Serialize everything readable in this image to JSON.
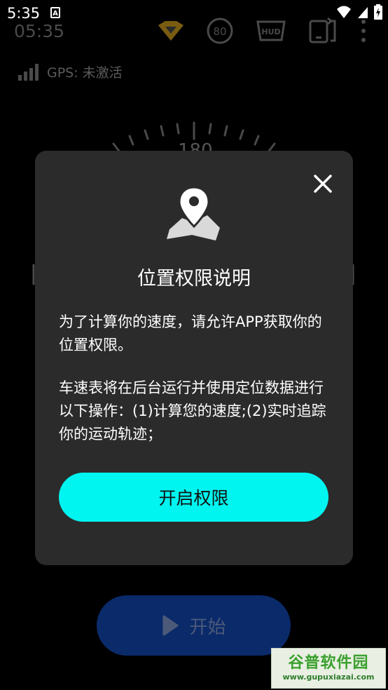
{
  "status_bar": {
    "time": "5:35",
    "a_badge": "A"
  },
  "app": {
    "clock": "05:35",
    "toolbar": {
      "speed_limit_value": "80",
      "hud_label": "HUD"
    },
    "gps": {
      "label": "GPS: 未激活"
    },
    "gauge_top_value": "180"
  },
  "dialog": {
    "title": "位置权限说明",
    "paragraph1": "为了计算你的速度，请允许APP获取你的 位置权限。",
    "paragraph2": "车速表将在后台运行并使用定位数据进行 以下操作：(1)计算您的速度;(2)实时追踪 你的运动轨迹；",
    "grant_button": "开启权限"
  },
  "start_button": {
    "label": "开始"
  },
  "watermark": {
    "title": "谷普软件园",
    "url": "www.gupuxiazai.com"
  },
  "colors": {
    "accent_cyan": "#00f5f0",
    "dialog_bg": "#2b2b2b",
    "start_button_bg": "#0a2a6a",
    "badge_gold": "#8a6a10"
  }
}
